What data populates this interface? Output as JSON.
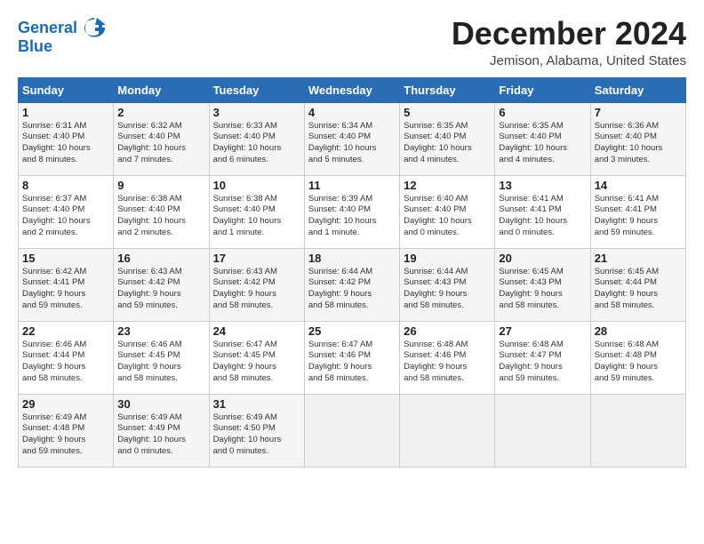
{
  "header": {
    "logo_line1": "General",
    "logo_line2": "Blue",
    "month": "December 2024",
    "location": "Jemison, Alabama, United States"
  },
  "weekdays": [
    "Sunday",
    "Monday",
    "Tuesday",
    "Wednesday",
    "Thursday",
    "Friday",
    "Saturday"
  ],
  "weeks": [
    [
      {
        "day": "1",
        "info": "Sunrise: 6:31 AM\nSunset: 4:40 PM\nDaylight: 10 hours\nand 8 minutes."
      },
      {
        "day": "2",
        "info": "Sunrise: 6:32 AM\nSunset: 4:40 PM\nDaylight: 10 hours\nand 7 minutes."
      },
      {
        "day": "3",
        "info": "Sunrise: 6:33 AM\nSunset: 4:40 PM\nDaylight: 10 hours\nand 6 minutes."
      },
      {
        "day": "4",
        "info": "Sunrise: 6:34 AM\nSunset: 4:40 PM\nDaylight: 10 hours\nand 5 minutes."
      },
      {
        "day": "5",
        "info": "Sunrise: 6:35 AM\nSunset: 4:40 PM\nDaylight: 10 hours\nand 4 minutes."
      },
      {
        "day": "6",
        "info": "Sunrise: 6:35 AM\nSunset: 4:40 PM\nDaylight: 10 hours\nand 4 minutes."
      },
      {
        "day": "7",
        "info": "Sunrise: 6:36 AM\nSunset: 4:40 PM\nDaylight: 10 hours\nand 3 minutes."
      }
    ],
    [
      {
        "day": "8",
        "info": "Sunrise: 6:37 AM\nSunset: 4:40 PM\nDaylight: 10 hours\nand 2 minutes."
      },
      {
        "day": "9",
        "info": "Sunrise: 6:38 AM\nSunset: 4:40 PM\nDaylight: 10 hours\nand 2 minutes."
      },
      {
        "day": "10",
        "info": "Sunrise: 6:38 AM\nSunset: 4:40 PM\nDaylight: 10 hours\nand 1 minute."
      },
      {
        "day": "11",
        "info": "Sunrise: 6:39 AM\nSunset: 4:40 PM\nDaylight: 10 hours\nand 1 minute."
      },
      {
        "day": "12",
        "info": "Sunrise: 6:40 AM\nSunset: 4:40 PM\nDaylight: 10 hours\nand 0 minutes."
      },
      {
        "day": "13",
        "info": "Sunrise: 6:41 AM\nSunset: 4:41 PM\nDaylight: 10 hours\nand 0 minutes."
      },
      {
        "day": "14",
        "info": "Sunrise: 6:41 AM\nSunset: 4:41 PM\nDaylight: 9 hours\nand 59 minutes."
      }
    ],
    [
      {
        "day": "15",
        "info": "Sunrise: 6:42 AM\nSunset: 4:41 PM\nDaylight: 9 hours\nand 59 minutes."
      },
      {
        "day": "16",
        "info": "Sunrise: 6:43 AM\nSunset: 4:42 PM\nDaylight: 9 hours\nand 59 minutes."
      },
      {
        "day": "17",
        "info": "Sunrise: 6:43 AM\nSunset: 4:42 PM\nDaylight: 9 hours\nand 58 minutes."
      },
      {
        "day": "18",
        "info": "Sunrise: 6:44 AM\nSunset: 4:42 PM\nDaylight: 9 hours\nand 58 minutes."
      },
      {
        "day": "19",
        "info": "Sunrise: 6:44 AM\nSunset: 4:43 PM\nDaylight: 9 hours\nand 58 minutes."
      },
      {
        "day": "20",
        "info": "Sunrise: 6:45 AM\nSunset: 4:43 PM\nDaylight: 9 hours\nand 58 minutes."
      },
      {
        "day": "21",
        "info": "Sunrise: 6:45 AM\nSunset: 4:44 PM\nDaylight: 9 hours\nand 58 minutes."
      }
    ],
    [
      {
        "day": "22",
        "info": "Sunrise: 6:46 AM\nSunset: 4:44 PM\nDaylight: 9 hours\nand 58 minutes."
      },
      {
        "day": "23",
        "info": "Sunrise: 6:46 AM\nSunset: 4:45 PM\nDaylight: 9 hours\nand 58 minutes."
      },
      {
        "day": "24",
        "info": "Sunrise: 6:47 AM\nSunset: 4:45 PM\nDaylight: 9 hours\nand 58 minutes."
      },
      {
        "day": "25",
        "info": "Sunrise: 6:47 AM\nSunset: 4:46 PM\nDaylight: 9 hours\nand 58 minutes."
      },
      {
        "day": "26",
        "info": "Sunrise: 6:48 AM\nSunset: 4:46 PM\nDaylight: 9 hours\nand 58 minutes."
      },
      {
        "day": "27",
        "info": "Sunrise: 6:48 AM\nSunset: 4:47 PM\nDaylight: 9 hours\nand 59 minutes."
      },
      {
        "day": "28",
        "info": "Sunrise: 6:48 AM\nSunset: 4:48 PM\nDaylight: 9 hours\nand 59 minutes."
      }
    ],
    [
      {
        "day": "29",
        "info": "Sunrise: 6:49 AM\nSunset: 4:48 PM\nDaylight: 9 hours\nand 59 minutes."
      },
      {
        "day": "30",
        "info": "Sunrise: 6:49 AM\nSunset: 4:49 PM\nDaylight: 10 hours\nand 0 minutes."
      },
      {
        "day": "31",
        "info": "Sunrise: 6:49 AM\nSunset: 4:50 PM\nDaylight: 10 hours\nand 0 minutes."
      },
      {
        "day": "",
        "info": ""
      },
      {
        "day": "",
        "info": ""
      },
      {
        "day": "",
        "info": ""
      },
      {
        "day": "",
        "info": ""
      }
    ]
  ]
}
